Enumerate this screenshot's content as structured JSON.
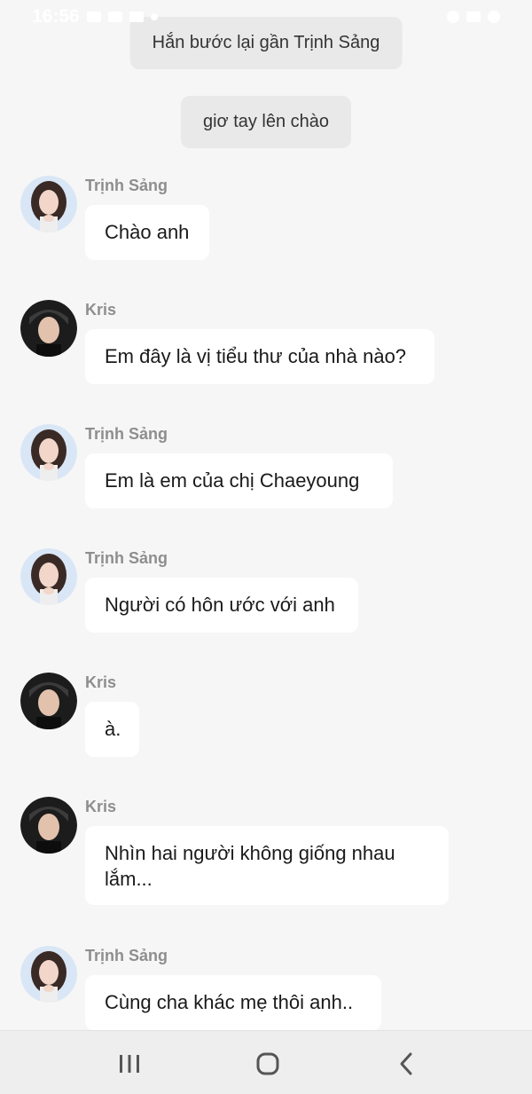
{
  "status_bar": {
    "time": "16:56"
  },
  "narrations": [
    {
      "text": "Hắn bước lại gần Trịnh Sảng"
    },
    {
      "text": "giơ tay lên chào"
    }
  ],
  "messages": [
    {
      "sender": "Trịnh Sảng",
      "avatar": "female-avatar",
      "text": "Chào anh"
    },
    {
      "sender": "Kris",
      "avatar": "male-avatar",
      "text": "Em đây là vị tiểu thư của nhà nào?"
    },
    {
      "sender": "Trịnh Sảng",
      "avatar": "female-avatar",
      "text": "Em  là em của chị Chaeyoung"
    },
    {
      "sender": "Trịnh Sảng",
      "avatar": "female-avatar",
      "text": "Người có hôn ước với anh"
    },
    {
      "sender": "Kris",
      "avatar": "male-avatar",
      "text": "à."
    },
    {
      "sender": "Kris",
      "avatar": "male-avatar",
      "text": "Nhìn hai người không giống nhau lắm..."
    },
    {
      "sender": "Trịnh Sảng",
      "avatar": "female-avatar",
      "text": "Cùng cha khác mẹ thôi anh.."
    }
  ],
  "nav_bar": {
    "buttons": [
      "recent-apps-icon",
      "home-icon",
      "back-icon"
    ]
  }
}
